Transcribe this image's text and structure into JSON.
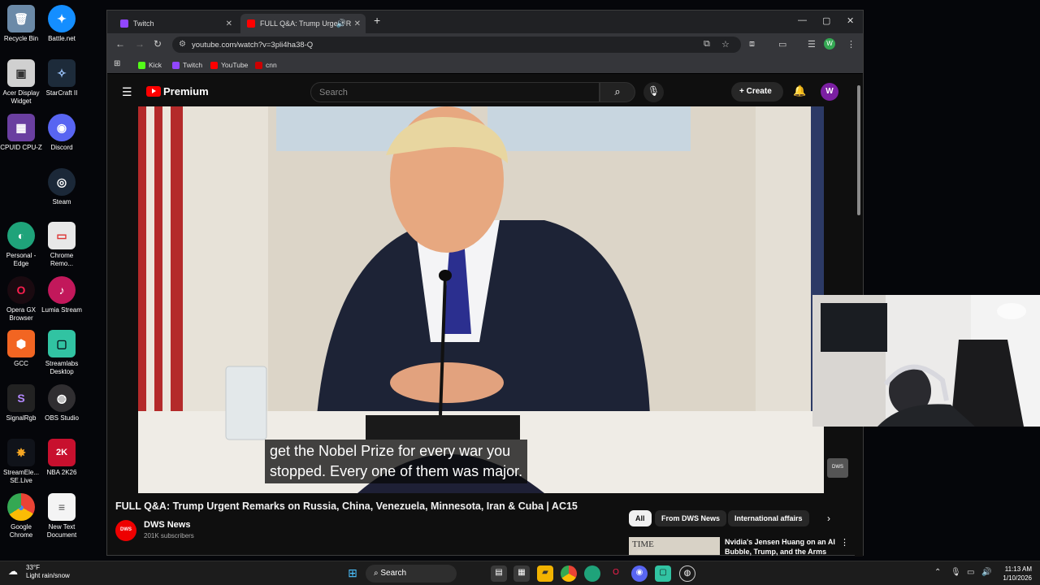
{
  "desktop": {
    "icons": [
      {
        "label": "Recycle Bin",
        "icon": "recycle-bin-icon",
        "glyph": "🗑"
      },
      {
        "label": "Battle.net",
        "icon": "battlenet-icon",
        "glyph": "✦"
      },
      {
        "label": "Acer Display Widget",
        "icon": "acer-display-icon",
        "glyph": "▣"
      },
      {
        "label": "StarCraft II",
        "icon": "starcraft-icon",
        "glyph": "✧"
      },
      {
        "label": "CPUID CPU-Z",
        "icon": "cpuz-icon",
        "glyph": "▦"
      },
      {
        "label": "Discord",
        "icon": "discord-icon",
        "glyph": "◉"
      },
      {
        "label": "Steam",
        "icon": "steam-icon",
        "glyph": "◎"
      },
      {
        "label": "Personal - Edge",
        "icon": "edge-icon",
        "glyph": "◐"
      },
      {
        "label": "Chrome Remo...",
        "icon": "chrome-remote-icon",
        "glyph": "▭"
      },
      {
        "label": "Opera GX Browser",
        "icon": "opera-gx-icon",
        "glyph": "O"
      },
      {
        "label": "Lumia Stream",
        "icon": "lumia-stream-icon",
        "glyph": "♪"
      },
      {
        "label": "GCC",
        "icon": "gcc-icon",
        "glyph": "⬢"
      },
      {
        "label": "Streamlabs Desktop",
        "icon": "streamlabs-icon",
        "glyph": "▢"
      },
      {
        "label": "SignalRgb",
        "icon": "signalrgb-icon",
        "glyph": "S"
      },
      {
        "label": "OBS Studio",
        "icon": "obs-icon",
        "glyph": "◍"
      },
      {
        "label": "StreamEle... SE.Live",
        "icon": "streamelements-icon",
        "glyph": "✸"
      },
      {
        "label": "NBA 2K26",
        "icon": "nba2k-icon",
        "glyph": "2K"
      },
      {
        "label": "Google Chrome",
        "icon": "chrome-icon",
        "glyph": "◕"
      },
      {
        "label": "New Text Document",
        "icon": "text-document-icon",
        "glyph": "≡"
      }
    ]
  },
  "browser": {
    "tabs": [
      {
        "title": "Twitch",
        "active": false
      },
      {
        "title": "FULL Q&A: Trump Urgent R",
        "active": true
      }
    ],
    "url": "youtube.com/watch?v=3pli4ha38-Q",
    "bookmarks": [
      "Kick",
      "Twitch",
      "YouTube",
      "cnn"
    ],
    "profile_initial": "W"
  },
  "youtube": {
    "brand": "Premium",
    "search_placeholder": "Search",
    "create_label": "Create",
    "avatar_initial": "W",
    "caption_line1": "get the Nobel Prize for every war you",
    "caption_line2": "stopped. Every one of them was major.",
    "watermark": "DWS",
    "video_title": "FULL Q&A: Trump Urgent Remarks on Russia, China, Venezuela, Minnesota, Iran & Cuba | AC15",
    "channel_name": "DWS News",
    "subscribers": "201K subscribers",
    "channel_logo": "DWS",
    "chips": [
      "All",
      "From DWS News",
      "International affairs"
    ],
    "recommendation": {
      "thumb_text": "TIME",
      "title": "Nvidia's Jensen Huang on an AI Bubble, Trump, and the Arms"
    }
  },
  "taskbar": {
    "weather_temp": "33°F",
    "weather_desc": "Light rain/snow",
    "search_label": "Search",
    "time": "11:13 AM",
    "date": "1/10/2026"
  }
}
